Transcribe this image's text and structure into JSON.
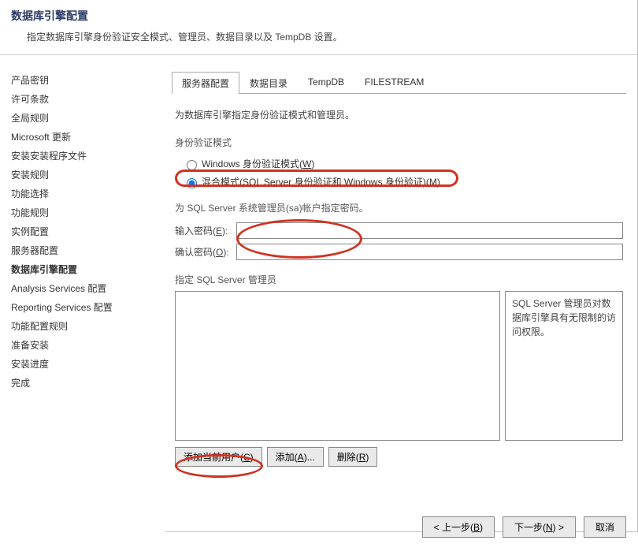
{
  "header": {
    "title": "数据库引擎配置",
    "subtitle": "指定数据库引擎身份验证安全模式、管理员、数据目录以及 TempDB 设置。"
  },
  "sidebar": {
    "items": [
      "产品密钥",
      "许可条款",
      "全局规则",
      "Microsoft 更新",
      "安装安装程序文件",
      "安装规则",
      "功能选择",
      "功能规则",
      "实例配置",
      "服务器配置",
      "数据库引擎配置",
      "Analysis Services 配置",
      "Reporting Services 配置",
      "功能配置规则",
      "准备安装",
      "安装进度",
      "完成"
    ],
    "current_index": 10
  },
  "tabs": [
    "服务器配置",
    "数据目录",
    "TempDB",
    "FILESTREAM"
  ],
  "active_tab": 0,
  "panel": {
    "intro": "为数据库引擎指定身份验证模式和管理员。",
    "auth_mode_label": "身份验证模式",
    "radio_windows_pre": "Windows 身份验证模式(",
    "radio_windows_key": "W",
    "radio_windows_post": ")",
    "radio_mixed_pre": "混合模式(SQL Server 身份验证和 Windows 身份验证)(",
    "radio_mixed_key": "M",
    "radio_mixed_post": ")",
    "sa_title": "为 SQL Server 系统管理员(sa)帐户指定密码。",
    "pw_label_pre": "输入密码(",
    "pw_label_key": "E",
    "pw_label_post": "):",
    "pw_value": "",
    "cpw_label_pre": "确认密码(",
    "cpw_label_key": "O",
    "cpw_label_post": "):",
    "cpw_value": "",
    "admins_label": "指定 SQL Server 管理员",
    "admins_side_text": "SQL Server 管理员对数据库引擎具有无限制的访问权限。",
    "btn_add_current_pre": "添加当前用户(",
    "btn_add_current_key": "C",
    "btn_add_current_post": ")",
    "btn_add_pre": "添加(",
    "btn_add_key": "A",
    "btn_add_post": ")...",
    "btn_remove_pre": "删除(",
    "btn_remove_key": "R",
    "btn_remove_post": ")"
  },
  "footer": {
    "back_pre": "< 上一步(",
    "back_key": "B",
    "back_post": ")",
    "next_pre": "下一步(",
    "next_key": "N",
    "next_post": ") >",
    "cancel": "取消"
  }
}
